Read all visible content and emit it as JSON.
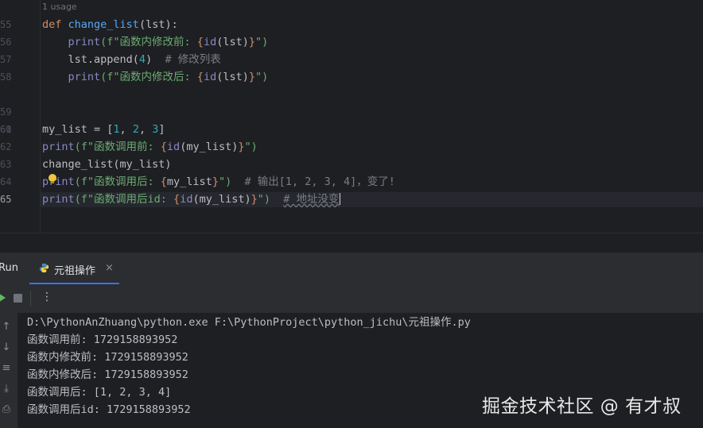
{
  "editor": {
    "usage_hint": "1 usage",
    "line_numbers": [
      "55",
      "56",
      "57",
      "58",
      "59",
      "60",
      "61",
      "62",
      "63",
      "64",
      "65"
    ],
    "code": {
      "l55": {
        "kw": "def",
        "fn": "change_list",
        "rest": "(lst):"
      },
      "l56": {
        "call": "print",
        "open": "(f\"函数内修改前: ",
        "b1": "{",
        "call2": "id",
        "mid": "(lst)",
        "b2": "}",
        "close": "\")"
      },
      "l57": {
        "text": "lst.append(",
        "num": "4",
        "text2": ")",
        "comment": "# 修改列表"
      },
      "l58": {
        "call": "print",
        "open": "(f\"函数内修改后: ",
        "b1": "{",
        "call2": "id",
        "mid": "(lst)",
        "b2": "}",
        "close": "\")"
      },
      "l61": {
        "text": "my_list = [",
        "n1": "1",
        "c1": ", ",
        "n2": "2",
        "c2": ", ",
        "n3": "3",
        "text2": "]"
      },
      "l62": {
        "call": "print",
        "open": "(f\"函数调用前: ",
        "b1": "{",
        "call2": "id",
        "mid": "(my_list)",
        "b2": "}",
        "close": "\")"
      },
      "l63": {
        "text": "change_list(my_list)"
      },
      "l64": {
        "call": "print",
        "open": "(f\"函数调用后: ",
        "b1": "{",
        "mid": "my_list",
        "b2": "}",
        "close": "\")",
        "comment": "# 输出[1, 2, 3, 4]，变了!"
      },
      "l65": {
        "call": "print",
        "open": "(f\"函数调用后id: ",
        "b1": "{",
        "call2": "id",
        "mid": "(my_list)",
        "b2": "}",
        "close": "\")",
        "comment": "# 地址没变"
      }
    }
  },
  "run_panel": {
    "title": "Run",
    "tab_label": "元祖操作",
    "tab_close": "×",
    "more": "⋮",
    "console_lines": [
      "D:\\PythonAnZhuang\\python.exe F:\\PythonProject\\python_jichu\\元祖操作.py",
      "函数调用前: 1729158893952",
      "函数内修改前: 1729158893952",
      "函数内修改后: 1729158893952",
      "函数调用后: [1, 2, 3, 4]",
      "函数调用后id: 1729158893952"
    ],
    "side_icons": [
      "↑",
      "↓",
      "≡",
      "⤓",
      "⎙"
    ]
  },
  "watermark": "掘金技术社区 @ 有才叔",
  "colors": {
    "background": "#1e1f22",
    "keyword": "#cf8e6d",
    "function": "#56a8f5",
    "builtin": "#8888c6",
    "string": "#6aab73",
    "number": "#2aacb8",
    "comment": "#7a7e85",
    "accent": "#3574f0"
  }
}
